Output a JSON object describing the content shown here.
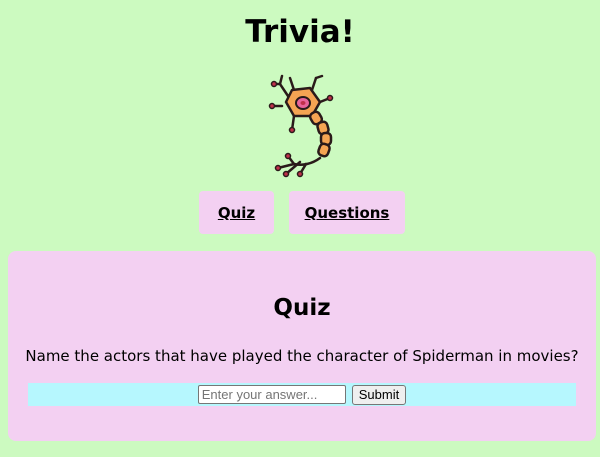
{
  "header": {
    "title": "Trivia!"
  },
  "logo": {
    "icon": "neuron-icon",
    "colors": {
      "body": "#f5a453",
      "nucleus": "#e8649a",
      "outline": "#2a1a1a",
      "dendrite_tips": "#c0304a"
    }
  },
  "nav": {
    "quiz_label": "Quiz",
    "questions_label": "Questions"
  },
  "quiz": {
    "heading": "Quiz",
    "question": "Name the actors that have played the character of Spiderman in movies?",
    "answer_placeholder": "Enter your answer...",
    "answer_value": "",
    "submit_label": "Submit"
  },
  "colors": {
    "page_background": "#ccfac0",
    "panel_background": "#f3d0f2",
    "answer_row_background": "#b6f7fe"
  }
}
